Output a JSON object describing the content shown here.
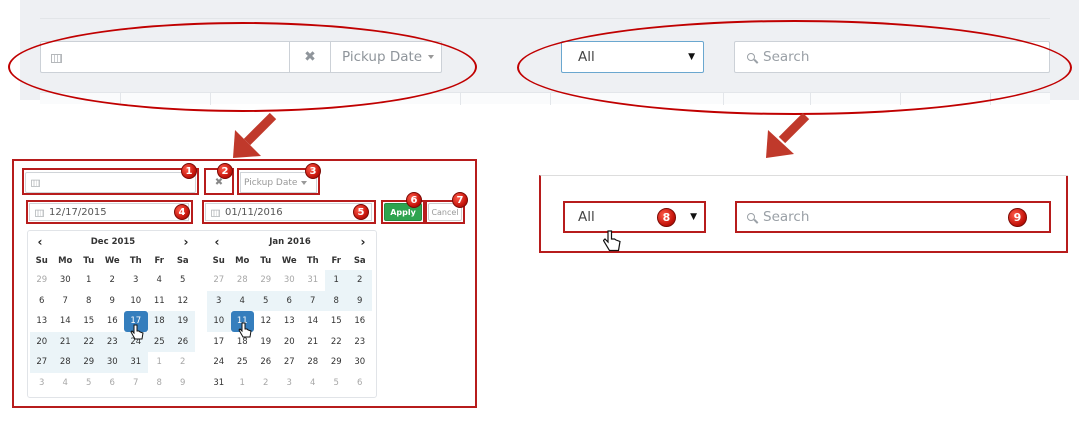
{
  "top": {
    "daterange": {
      "value": "",
      "clear_icon": "times-icon",
      "dropdown_label": "Pickup Date"
    },
    "filter_select": {
      "value": "All"
    },
    "search": {
      "placeholder": "Search"
    }
  },
  "datepicker": {
    "daterange_value": "",
    "dropdown_label": "Pickup Date",
    "start_date": "12/17/2015",
    "end_date": "01/11/2016",
    "apply_label": "Apply",
    "cancel_label": "Cancel",
    "weekdays": [
      "Su",
      "Mo",
      "Tu",
      "We",
      "Th",
      "Fr",
      "Sa"
    ],
    "left_month": {
      "title": "Dec 2015",
      "weeks": [
        [
          "29",
          "30",
          "1",
          "2",
          "3",
          "4",
          "5"
        ],
        [
          "6",
          "7",
          "8",
          "9",
          "10",
          "11",
          "12"
        ],
        [
          "13",
          "14",
          "15",
          "16",
          "17",
          "18",
          "19"
        ],
        [
          "20",
          "21",
          "22",
          "23",
          "24",
          "25",
          "26"
        ],
        [
          "27",
          "28",
          "29",
          "30",
          "31",
          "1",
          "2"
        ],
        [
          "3",
          "4",
          "5",
          "6",
          "7",
          "8",
          "9"
        ]
      ],
      "cell_state": [
        [
          "off",
          "",
          "",
          "",
          "",
          "",
          ""
        ],
        [
          "",
          "",
          "",
          "",
          "",
          "",
          ""
        ],
        [
          "",
          "",
          "",
          "",
          "sel",
          "inr",
          "inr"
        ],
        [
          "inr",
          "inr",
          "inr",
          "inr",
          "inr",
          "inr",
          "inr"
        ],
        [
          "inr",
          "inr",
          "inr",
          "inr",
          "inr",
          "off",
          "off"
        ],
        [
          "off",
          "off",
          "off",
          "off",
          "off",
          "off",
          "off"
        ]
      ]
    },
    "right_month": {
      "title": "Jan 2016",
      "weeks": [
        [
          "27",
          "28",
          "29",
          "30",
          "31",
          "1",
          "2"
        ],
        [
          "3",
          "4",
          "5",
          "6",
          "7",
          "8",
          "9"
        ],
        [
          "10",
          "11",
          "12",
          "13",
          "14",
          "15",
          "16"
        ],
        [
          "17",
          "18",
          "19",
          "20",
          "21",
          "22",
          "23"
        ],
        [
          "24",
          "25",
          "26",
          "27",
          "28",
          "29",
          "30"
        ],
        [
          "31",
          "1",
          "2",
          "3",
          "4",
          "5",
          "6"
        ]
      ],
      "cell_state": [
        [
          "off",
          "off",
          "off",
          "off",
          "off",
          "inr",
          "inr"
        ],
        [
          "inr",
          "inr",
          "inr",
          "inr",
          "inr",
          "inr",
          "inr"
        ],
        [
          "inr",
          "sel",
          "",
          "",
          "",
          "",
          ""
        ],
        [
          "",
          "",
          "",
          "",
          "",
          "",
          ""
        ],
        [
          "",
          "",
          "",
          "",
          "",
          "",
          ""
        ],
        [
          "",
          "off",
          "off",
          "off",
          "off",
          "off",
          "off"
        ]
      ]
    }
  },
  "right_panel": {
    "filter_select": {
      "value": "All"
    },
    "search": {
      "placeholder": "Search"
    }
  },
  "badges": [
    "1",
    "2",
    "3",
    "4",
    "5",
    "6",
    "7",
    "8",
    "9"
  ],
  "colors": {
    "annotation_red": "#c00000",
    "apply_green": "#2ea44f",
    "selected_blue": "#357ebd"
  }
}
